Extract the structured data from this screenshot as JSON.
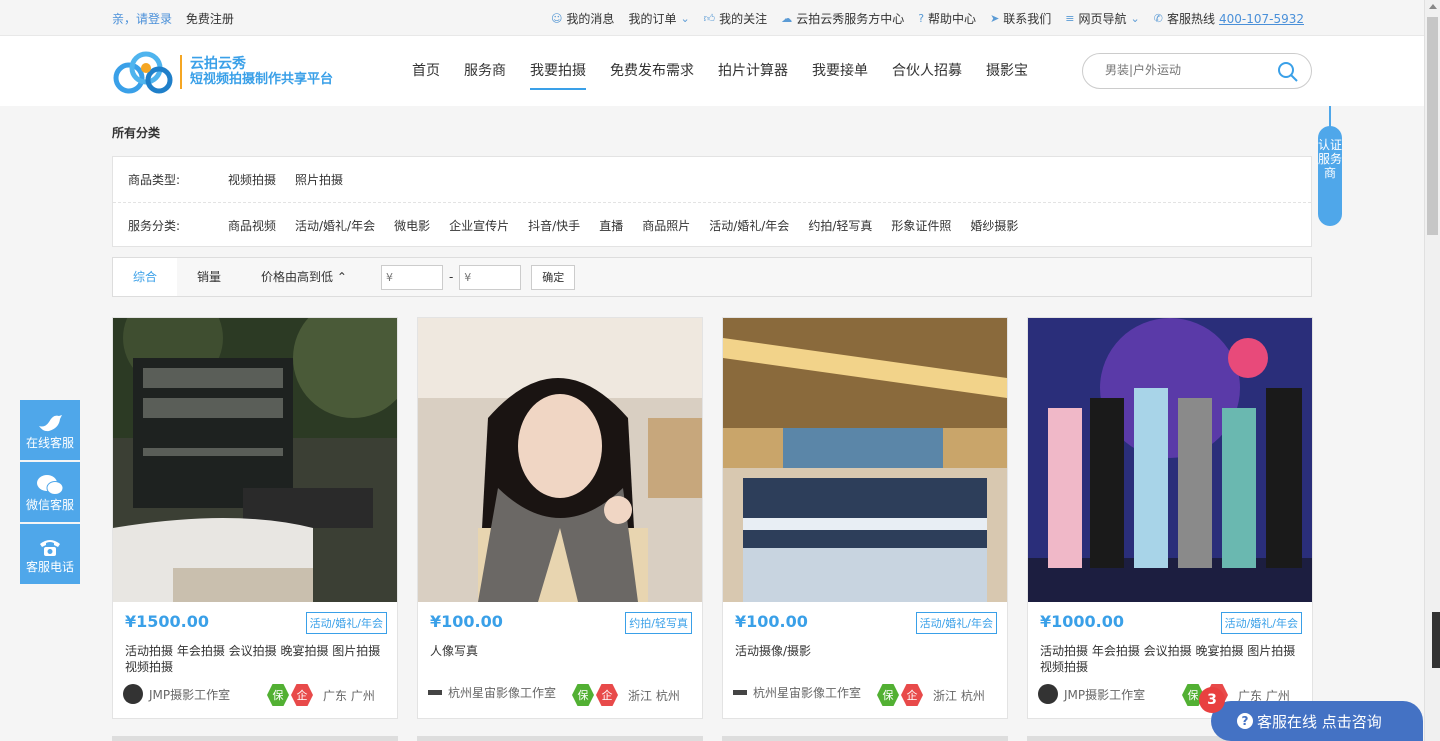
{
  "topbar": {
    "login": "亲，请登录",
    "register": "免费注册",
    "links": [
      {
        "icon": "message-icon",
        "label": "我的消息"
      },
      {
        "icon": "",
        "label": "我的订单"
      },
      {
        "icon": "thumb-icon",
        "label": "我的关注"
      },
      {
        "icon": "cloud-icon",
        "label": "云拍云秀服务方中心"
      },
      {
        "icon": "help-icon",
        "label": "帮助中心"
      },
      {
        "icon": "send-icon",
        "label": "联系我们"
      },
      {
        "icon": "menu-icon",
        "label": "网页导航"
      }
    ],
    "hotline_label": "客服热线",
    "hotline": "400-107-5932"
  },
  "logo": {
    "line1": "云拍云秀",
    "line2": "短视频拍摄制作共享平台"
  },
  "nav": [
    "首页",
    "服务商",
    "我要拍摄",
    "免费发布需求",
    "拍片计算器",
    "我要接单",
    "合伙人招募",
    "摄影宝"
  ],
  "search": {
    "placeholder": "男装|户外运动"
  },
  "crumb": "所有分类",
  "filter": {
    "type_label": "商品类型:",
    "types": [
      "视频拍摄",
      "照片拍摄"
    ],
    "service_label": "服务分类:",
    "services": [
      "商品视频",
      "活动/婚礼/年会",
      "微电影",
      "企业宣传片",
      "抖音/快手",
      "直播",
      "商品照片",
      "活动/婚礼/年会",
      "约拍/轻写真",
      "形象证件照",
      "婚纱摄影"
    ]
  },
  "sort": {
    "tabs": [
      "综合",
      "销量",
      "价格由高到低"
    ],
    "min_placeholder": "¥",
    "max_placeholder": "¥",
    "dash": "-",
    "confirm": "确定"
  },
  "cards": [
    {
      "price": "¥1500.00",
      "tag": "活动/婚礼/年会",
      "desc": "活动拍摄 年会拍摄 会议拍摄 晚宴拍摄 图片拍摄 视频拍摄",
      "shop": "JMP摄影工作室",
      "badge1": "保",
      "badge2": "企",
      "loc": "广东 广州"
    },
    {
      "price": "¥100.00",
      "tag": "约拍/轻写真",
      "desc": "人像写真",
      "shop": "杭州星宙影像工作室",
      "badge1": "保",
      "badge2": "企",
      "loc": "浙江 杭州"
    },
    {
      "price": "¥100.00",
      "tag": "活动/婚礼/年会",
      "desc": "活动摄像/摄影",
      "shop": "杭州星宙影像工作室",
      "badge1": "保",
      "badge2": "企",
      "loc": "浙江 杭州"
    },
    {
      "price": "¥1000.00",
      "tag": "活动/婚礼/年会",
      "desc": "活动拍摄 年会拍摄 会议拍摄 晚宴拍摄 图片拍摄 视频拍摄",
      "shop": "JMP摄影工作室",
      "badge1": "保",
      "badge2": "企",
      "loc": "广东 广州"
    }
  ],
  "float": [
    "在线客服",
    "微信客服",
    "客服电话"
  ],
  "cert": "认证服务商",
  "chat": {
    "label": "客服在线 点击咨询",
    "count": "3",
    "q": "?"
  },
  "colors": {
    "accent": "#3aa0e8",
    "float": "#4fa7ea",
    "chat": "#4472c4",
    "badge_green": "#52b033",
    "badge_red": "#e84a4a"
  }
}
